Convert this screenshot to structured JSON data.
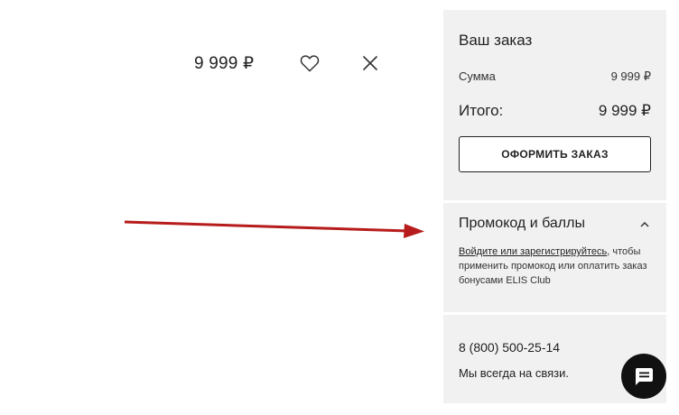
{
  "item": {
    "price": "9 999 ₽",
    "favorite_icon": "heart-icon",
    "remove_icon": "close-icon"
  },
  "annotation": {
    "arrow_color": "#b71c1c"
  },
  "summary": {
    "title": "Ваш заказ",
    "sum_label": "Сумма",
    "sum_value": "9 999 ₽",
    "total_label": "Итого:",
    "total_value": "9 999 ₽",
    "checkout_label": "ОФОРМИТЬ ЗАКАЗ"
  },
  "promo": {
    "title": "Промокод и баллы",
    "toggle_icon": "chevron-up-icon",
    "link_text": "Войдите или зарегистрируйтесь",
    "text_rest": ", чтобы применить промокод или оплатить заказ бонусами ELIS Club"
  },
  "contact": {
    "phone": "8 (800) 500-25-14",
    "tagline": "Мы всегда на связи."
  },
  "chat": {
    "icon": "chat-icon",
    "bg_color": "#111111"
  }
}
